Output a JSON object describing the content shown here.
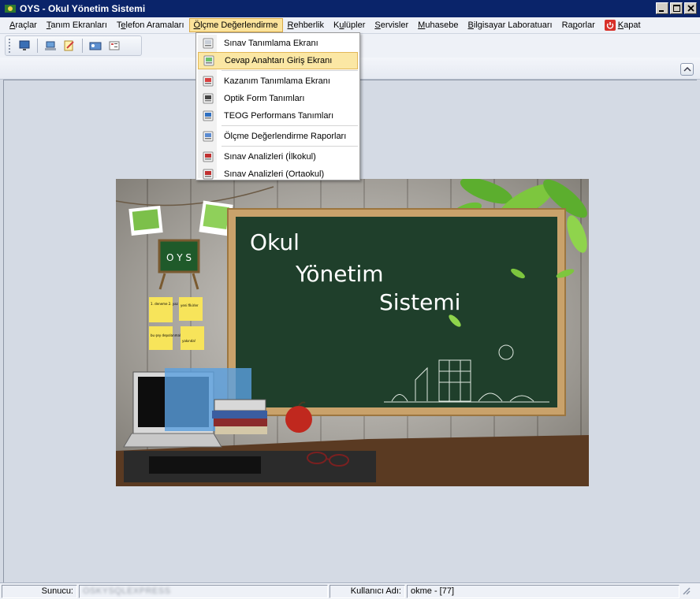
{
  "window": {
    "title": "OYS - Okul Yönetim Sistemi",
    "controls": [
      "minimize-icon",
      "maximize-icon",
      "close-icon"
    ]
  },
  "menu": {
    "items": [
      {
        "label": "Araçlar",
        "underline": "A"
      },
      {
        "label": "Tanım Ekranları",
        "underline": "T"
      },
      {
        "label": "Telefon Aramaları",
        "underline": "e"
      },
      {
        "label": "Ölçme Değerlendirme",
        "underline": "Ö",
        "active": true
      },
      {
        "label": "Rehberlik",
        "underline": "R"
      },
      {
        "label": "Kulüpler",
        "underline": "u"
      },
      {
        "label": "Servisler",
        "underline": "S"
      },
      {
        "label": "Muhasebe",
        "underline": "M"
      },
      {
        "label": "Bilgisayar Laboratuarı",
        "underline": "B"
      },
      {
        "label": "Raporlar",
        "underline": "p"
      },
      {
        "label": "Kapat",
        "underline": "K",
        "icon": "power-icon"
      }
    ]
  },
  "dropdown": {
    "items": [
      {
        "label": "Sınav Tanımlama Ekranı",
        "icon": "exam-doc-icon"
      },
      {
        "label": "Cevap Anahtarı Giriş Ekranı",
        "icon": "answer-key-icon",
        "selected": true
      },
      {
        "sep": true
      },
      {
        "label": "Kazanım Tanımlama Ekranı",
        "icon": "outcome-icon"
      },
      {
        "label": "Optik Form Tanımları",
        "icon": "optical-form-icon"
      },
      {
        "label": "TEOG Performans Tanımları",
        "icon": "performance-icon"
      },
      {
        "sep": true
      },
      {
        "label": "Ölçme Değerlendirme Raporları",
        "icon": "report-icon"
      },
      {
        "sep": true
      },
      {
        "label": "Sınav Analizleri (İlkokul)",
        "icon": "analysis-icon"
      },
      {
        "label": "Sınav Analizleri (Ortaokul)",
        "icon": "analysis-icon"
      }
    ]
  },
  "splash": {
    "line1": "Okul",
    "line2": "Yönetim",
    "line3": "Sistemi",
    "badge": "O Y S",
    "notes": [
      "1. deneme 2. yaz 3. kontrol",
      "yeni fikirler",
      "bu şey depolanmalı",
      "yakında!"
    ]
  },
  "status": {
    "server_label": "Sunucu:",
    "server_value": "OSKYSQLEXPRESS",
    "user_label": "Kullanıcı Adı:",
    "user_value": "okme - [77]"
  },
  "colors": {
    "titlebar": "#0a246a",
    "menu_active_bg": "#fbe39b",
    "chalkboard": "#1f3f2b",
    "frame": "#c9a26b"
  }
}
